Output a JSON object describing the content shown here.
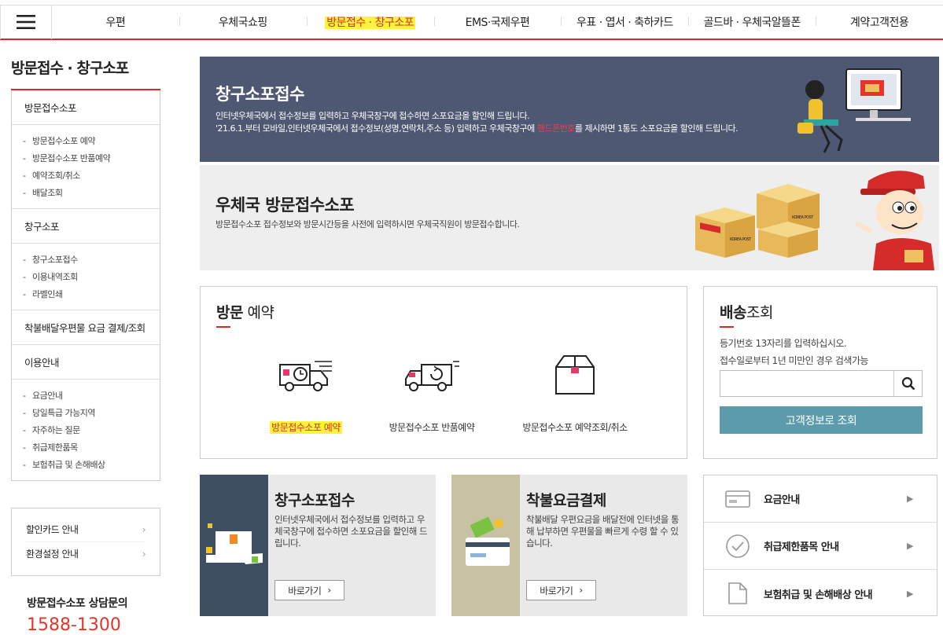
{
  "nav": {
    "items": [
      {
        "label": "우편"
      },
      {
        "label": "우체국쇼핑"
      },
      {
        "label": "방문접수 · 창구소포",
        "active": true
      },
      {
        "label": "EMS·국제우편"
      },
      {
        "label": "우표 · 엽서 · 축하카드"
      },
      {
        "label": "골드바 · 우체국알뜰폰"
      },
      {
        "label": "계약고객전용"
      }
    ]
  },
  "sidebar": {
    "title": "방문접수 · 창구소포",
    "groups": [
      {
        "title": "방문접수소포",
        "items": [
          "방문접수소포 예약",
          "방문접수소포 반품예약",
          "예약조회/취소",
          "배달조회"
        ]
      },
      {
        "title": "창구소포",
        "items": [
          "창구소포접수",
          "이용내역조회",
          "라벨인쇄"
        ]
      },
      {
        "title": "착불배달우편물 요금 결제/조회",
        "items": []
      },
      {
        "title": "이용안내",
        "items": [
          "요금안내",
          "당일특급 가능지역",
          "자주하는 질문",
          "취급제한품목",
          "보험취급 및 손해배상"
        ]
      }
    ],
    "links": [
      "할인카드 안내",
      "환경설정 안내"
    ],
    "consult_label": "방문접수소포 상담문의",
    "consult_phone": "1588-1300"
  },
  "banner1": {
    "title": "창구소포접수",
    "desc1": "인터넷우체국에서 접수정보를 입력하고 우체국창구에 접수하면 소포요금을 할인해 드립니다.",
    "desc2_a": "'21.6.1.부터 모바일,인터넷우체국에서 접수정보(성명,연락처,주소 등) 입력하고 우체국창구에 ",
    "desc2_hl": "핸드폰번호",
    "desc2_b": "를 제시하면 1통도 소포요금을 할인해 드립니다."
  },
  "banner2": {
    "title": "우체국 방문접수소포",
    "desc": "방문접수소포 접수정보와 방문시간등을 사전에 입력하시면 우체국직원이 방문접수합니다.",
    "box_label": "KOREA POST"
  },
  "visit": {
    "title_bold": "방문",
    "title_rest": " 예약",
    "items": [
      {
        "label": "방문접수소포 예약",
        "icon": "truck-clock-icon"
      },
      {
        "label": "방문접수소포 반품예약",
        "icon": "truck-return-icon"
      },
      {
        "label": "방문접수소포 예약조회/취소",
        "icon": "box-icon"
      }
    ]
  },
  "track": {
    "title_bold": "배송",
    "title_rest": "조회",
    "desc1": "등기번호 13자리를 입력하십시오.",
    "desc2": "접수일로부터 1년 미만인 경우 검색가능",
    "placeholder": "",
    "button": "고객정보로 조회"
  },
  "cards": [
    {
      "title": "창구소포접수",
      "desc": "인터넷우체국에서 접수정보를 입력하고 우체국창구에 접수하면 소포요금을 할인해 드립니다.",
      "button": "바로가기",
      "bg": "#3e4f63"
    },
    {
      "title": "착불요금결제",
      "desc": "착불배달 우편요금을 배달전에 인터넷을 통해 납부하면 우편물을 빠르게 수령 할 수 있습니다.",
      "button": "바로가기",
      "bg": "#c9c1a4"
    }
  ],
  "rlinks": [
    {
      "label": "요금안내",
      "icon": "card-icon"
    },
    {
      "label": "취급제한품목 안내",
      "icon": "check-circle-icon"
    },
    {
      "label": "보험취급 및 손해배상 안내",
      "icon": "document-icon"
    }
  ],
  "colors": {
    "accent": "#d62b2b",
    "highlight": "#fff43b",
    "teal": "#5b9bab",
    "banner_dark": "#4f5872"
  }
}
